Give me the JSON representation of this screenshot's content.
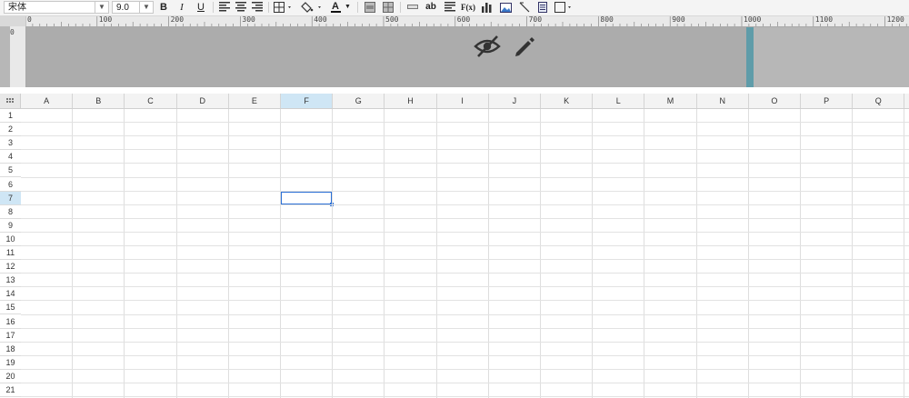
{
  "toolbar": {
    "font_name": "宋体",
    "font_size": "9.0",
    "bold_label": "B",
    "italic_label": "I",
    "underline_label": "U",
    "text_color_label": "A",
    "wrap_label": "ab",
    "formula_label": "F(x)"
  },
  "ruler": {
    "labels": [
      "0",
      "100",
      "200",
      "300",
      "400",
      "500",
      "600",
      "700",
      "800",
      "900",
      "1000",
      "1100",
      "1200"
    ],
    "vertical_label": "0"
  },
  "grid": {
    "columns": [
      "A",
      "B",
      "C",
      "D",
      "E",
      "F",
      "G",
      "H",
      "I",
      "J",
      "K",
      "L",
      "M",
      "N",
      "O",
      "P",
      "Q"
    ],
    "rows": [
      "1",
      "2",
      "3",
      "4",
      "5",
      "6",
      "7",
      "8",
      "9",
      "10",
      "11",
      "12",
      "13",
      "14",
      "15",
      "16",
      "17",
      "18",
      "19",
      "20",
      "21"
    ],
    "selected_column": "F",
    "selected_row": "7"
  },
  "colors": {
    "selection": "#2a6fd6",
    "pagebreak": "#5f9ca9",
    "header_highlight": "#cfe6f5"
  },
  "icons": [
    "hidden-eye-icon",
    "pencil-icon"
  ]
}
